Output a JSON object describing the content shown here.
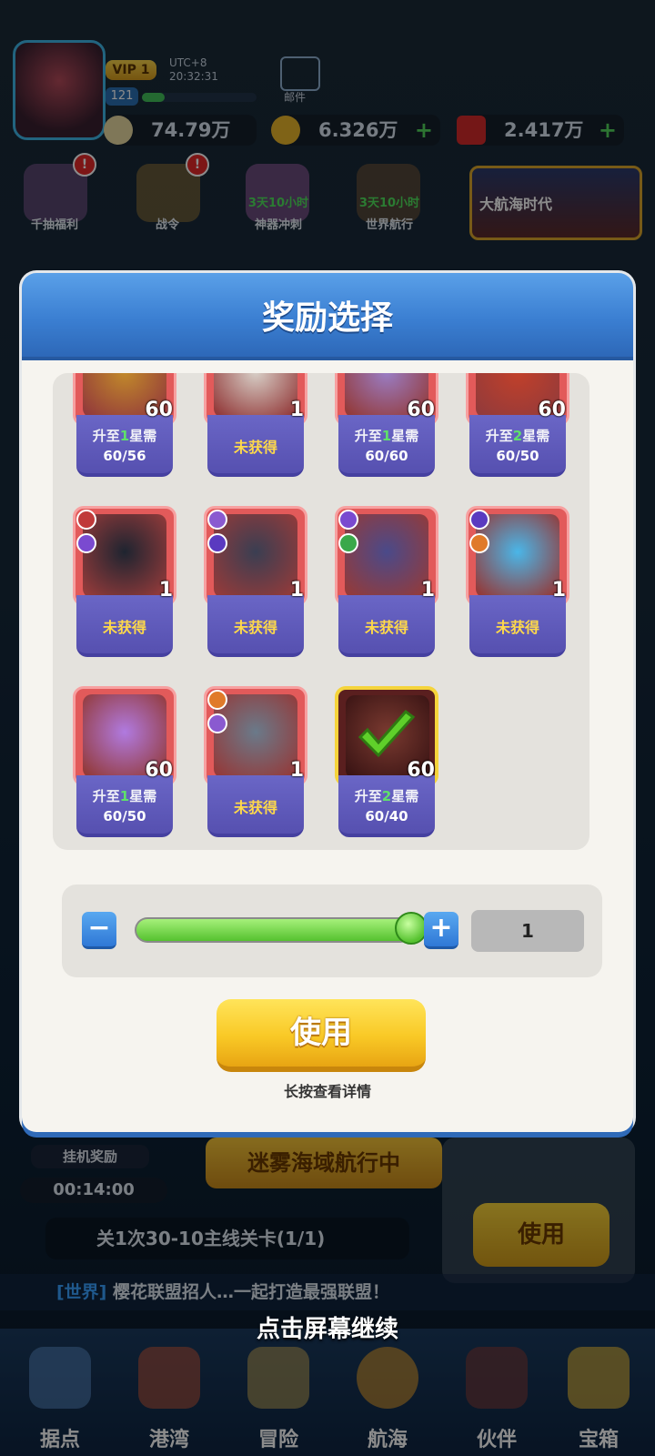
{
  "background": {
    "vip": "VIP 1",
    "utc": "UTC+8",
    "time": "20:32:31",
    "level": "121",
    "mail_label": "邮件",
    "resources": [
      "74.79万",
      "6.326万",
      "2.417万"
    ],
    "row_icons": [
      {
        "label": "千抽福利",
        "timer": ""
      },
      {
        "label": "战令",
        "timer": ""
      },
      {
        "label": "神器冲刺",
        "timer": "3天10小时"
      },
      {
        "label": "世界航行",
        "timer": "3天10小时"
      }
    ],
    "event_title": "大航海时代",
    "idle_label": "挂机奖励",
    "idle_time": "00:14:00",
    "sail_banner": "迷雾海域航行中",
    "use_bg": "使用",
    "quest": "关1次30-10主线关卡(1/1)",
    "chat_world": "[世界]",
    "chat_text": "樱花联盟招人…一起打造最强联盟！",
    "nav": [
      "据点",
      "港湾",
      "冒险",
      "航海",
      "伙伴",
      "宝箱"
    ],
    "continue": "点击屏幕继续"
  },
  "dialog": {
    "title": "奖励选择",
    "cards": [
      {
        "count": "60",
        "status": "upgrade",
        "pre": "升至",
        "star": "1",
        "post": "星需",
        "progress": "60/56",
        "color": "#c28a2a"
      },
      {
        "count": "1",
        "status": "not_obtained",
        "label": "未获得",
        "color": "#d8d0c8"
      },
      {
        "count": "60",
        "status": "upgrade",
        "pre": "升至",
        "star": "1",
        "post": "星需",
        "progress": "60/60",
        "color": "#9a7ec6"
      },
      {
        "count": "60",
        "status": "upgrade",
        "pre": "升至",
        "star": "2",
        "post": "星需",
        "progress": "60/50",
        "color": "#c2402a"
      },
      {
        "count": "1",
        "status": "not_obtained",
        "label": "未获得",
        "color": "#1e2430"
      },
      {
        "count": "1",
        "status": "not_obtained",
        "label": "未获得",
        "color": "#3a3e52"
      },
      {
        "count": "1",
        "status": "not_obtained",
        "label": "未获得",
        "color": "#4a4a8a"
      },
      {
        "count": "1",
        "status": "not_obtained",
        "label": "未获得",
        "color": "#4ab6e8"
      },
      {
        "count": "60",
        "status": "upgrade",
        "pre": "升至",
        "star": "1",
        "post": "星需",
        "progress": "60/50",
        "color": "#b07ae0"
      },
      {
        "count": "1",
        "status": "not_obtained",
        "label": "未获得",
        "color": "#6a7a8a"
      },
      {
        "count": "60",
        "status": "upgrade",
        "pre": "升至",
        "star": "2",
        "post": "星需",
        "progress": "60/40",
        "color": "#7a3a30",
        "selected": true
      }
    ],
    "slider_value": 1,
    "slider_fraction": 1.0,
    "quantity": "1",
    "minus": "−",
    "plus": "+",
    "use_label": "使用",
    "hint": "长按查看详情"
  }
}
